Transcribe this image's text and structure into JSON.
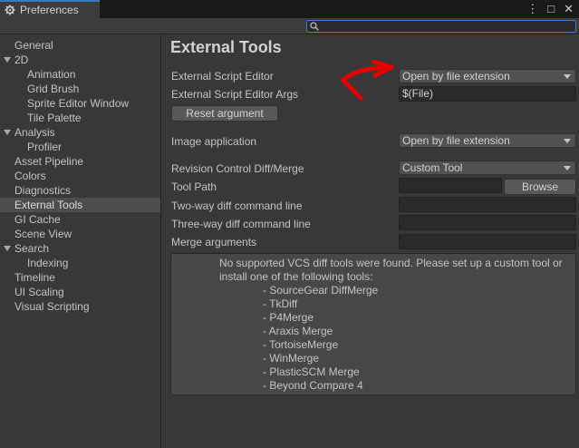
{
  "window": {
    "title": "Preferences",
    "controls": [
      "⋮",
      "□",
      "✕"
    ]
  },
  "search": {
    "placeholder": ""
  },
  "sidebar": {
    "items": [
      {
        "label": "General",
        "level": 0,
        "expandable": false,
        "selected": false
      },
      {
        "label": "2D",
        "level": 0,
        "expandable": true,
        "selected": false
      },
      {
        "label": "Animation",
        "level": 1,
        "expandable": false,
        "selected": false
      },
      {
        "label": "Grid Brush",
        "level": 1,
        "expandable": false,
        "selected": false
      },
      {
        "label": "Sprite Editor Window",
        "level": 1,
        "expandable": false,
        "selected": false
      },
      {
        "label": "Tile Palette",
        "level": 1,
        "expandable": false,
        "selected": false
      },
      {
        "label": "Analysis",
        "level": 0,
        "expandable": true,
        "selected": false
      },
      {
        "label": "Profiler",
        "level": 1,
        "expandable": false,
        "selected": false
      },
      {
        "label": "Asset Pipeline",
        "level": 0,
        "expandable": false,
        "selected": false
      },
      {
        "label": "Colors",
        "level": 0,
        "expandable": false,
        "selected": false
      },
      {
        "label": "Diagnostics",
        "level": 0,
        "expandable": false,
        "selected": false
      },
      {
        "label": "External Tools",
        "level": 0,
        "expandable": false,
        "selected": true
      },
      {
        "label": "GI Cache",
        "level": 0,
        "expandable": false,
        "selected": false
      },
      {
        "label": "Scene View",
        "level": 0,
        "expandable": false,
        "selected": false
      },
      {
        "label": "Search",
        "level": 0,
        "expandable": true,
        "selected": false
      },
      {
        "label": "Indexing",
        "level": 1,
        "expandable": false,
        "selected": false
      },
      {
        "label": "Timeline",
        "level": 0,
        "expandable": false,
        "selected": false
      },
      {
        "label": "UI Scaling",
        "level": 0,
        "expandable": false,
        "selected": false
      },
      {
        "label": "Visual Scripting",
        "level": 0,
        "expandable": false,
        "selected": false
      }
    ]
  },
  "main": {
    "title": "External Tools",
    "script_editor": {
      "label": "External Script Editor",
      "value": "Open by file extension"
    },
    "script_editor_args": {
      "label": "External Script Editor Args",
      "value": "$(File)"
    },
    "reset_argument_label": "Reset argument",
    "image_application": {
      "label": "Image application",
      "value": "Open by file extension"
    },
    "revision_control": {
      "label": "Revision Control Diff/Merge",
      "value": "Custom Tool"
    },
    "tool_path": {
      "label": "Tool Path",
      "value": "",
      "browse_label": "Browse"
    },
    "two_way": {
      "label": "Two-way diff command line",
      "value": ""
    },
    "three_way": {
      "label": "Three-way diff command line",
      "value": ""
    },
    "merge_args": {
      "label": "Merge arguments",
      "value": ""
    },
    "help": {
      "message": "No supported VCS diff tools were found. Please set up a custom tool or install one of the following tools:",
      "tools": [
        "- SourceGear DiffMerge",
        "- TkDiff",
        "- P4Merge",
        "- Araxis Merge",
        "- TortoiseMerge",
        "- WinMerge",
        "- PlasticSCM Merge",
        "- Beyond Compare 4"
      ]
    }
  },
  "colors": {
    "background": "#383838",
    "titlebar": "#191919",
    "accent": "#3a79bb",
    "annotation_arrow": "#e60000"
  },
  "icons": [
    "gear-icon",
    "search-icon",
    "kebab-menu-icon",
    "maximize-icon",
    "close-icon",
    "chevron-down-icon",
    "expand-caret-icon"
  ]
}
